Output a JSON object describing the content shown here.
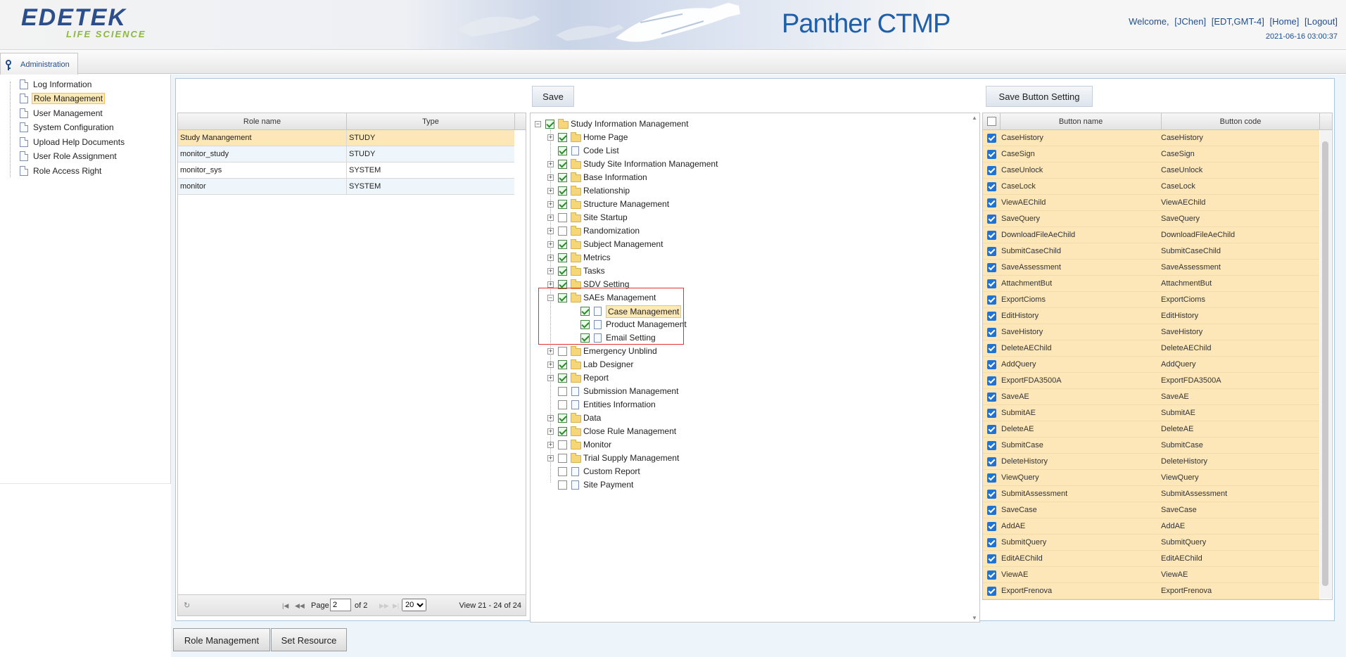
{
  "header": {
    "logo_line1": "EDETEK",
    "logo_line2": "LIFE SCIENCE",
    "app_title": "Panther CTMP",
    "welcome": "Welcome,",
    "user": "[JChen]",
    "timezone": "[EDT,GMT-4]",
    "home_link": "[Home]",
    "logout_link": "[Logout]",
    "datetime": "2021-06-16 03:00:37"
  },
  "tabs": {
    "admin": "Administration"
  },
  "sidebar": {
    "items": [
      {
        "label": "Log Information"
      },
      {
        "label": "Role Management"
      },
      {
        "label": "User Management"
      },
      {
        "label": "System Configuration"
      },
      {
        "label": "Upload Help Documents"
      },
      {
        "label": "User Role Assignment"
      },
      {
        "label": "Role Access Right"
      }
    ],
    "selected": "Role Management"
  },
  "toolbar": {
    "save": "Save",
    "save_button_setting": "Save Button Setting"
  },
  "roles": {
    "columns": [
      "Role name",
      "Type"
    ],
    "rows": [
      {
        "name": "Study Manangement",
        "type": "STUDY"
      },
      {
        "name": "monitor_study",
        "type": "STUDY"
      },
      {
        "name": "monitor_sys",
        "type": "SYSTEM"
      },
      {
        "name": "monitor",
        "type": "SYSTEM"
      }
    ],
    "pager": {
      "page_label": "Page",
      "page": "2",
      "of": "of 2",
      "page_size": "20",
      "view": "View 21 - 24 of 24"
    }
  },
  "tree": {
    "root": "Study Information Management",
    "nodes": [
      {
        "label": "Home Page",
        "checked": true
      },
      {
        "label": "Code List",
        "checked": true
      },
      {
        "label": "Study Site Information Management",
        "checked": true
      },
      {
        "label": "Base Information",
        "checked": true
      },
      {
        "label": "Relationship",
        "checked": true
      },
      {
        "label": "Structure Management",
        "checked": true
      },
      {
        "label": "Site Startup",
        "checked": false
      },
      {
        "label": "Randomization",
        "checked": false
      },
      {
        "label": "Subject Management",
        "checked": true
      },
      {
        "label": "Metrics",
        "checked": true
      },
      {
        "label": "Tasks",
        "checked": true
      },
      {
        "label": "SDV Setting",
        "checked": true
      },
      {
        "label": "SAEs Management",
        "checked": true
      },
      {
        "label": "Case Management",
        "checked": true
      },
      {
        "label": "Product Management",
        "checked": true
      },
      {
        "label": "Email Setting",
        "checked": true
      },
      {
        "label": "Emergency Unblind",
        "checked": false
      },
      {
        "label": "Lab Designer",
        "checked": true
      },
      {
        "label": "Report",
        "checked": true
      },
      {
        "label": "Submission Management",
        "checked": false
      },
      {
        "label": "Entities Information",
        "checked": false
      },
      {
        "label": "Data",
        "checked": true
      },
      {
        "label": "Close Rule Management",
        "checked": true
      },
      {
        "label": "Monitor",
        "checked": false
      },
      {
        "label": "Trial Supply Management",
        "checked": false
      },
      {
        "label": "Custom Report",
        "checked": false
      },
      {
        "label": "Site Payment",
        "checked": false
      }
    ]
  },
  "buttons": {
    "columns": [
      "Button name",
      "Button code"
    ],
    "rows": [
      [
        "CaseHistory",
        "CaseHistory"
      ],
      [
        "CaseSign",
        "CaseSign"
      ],
      [
        "CaseUnlock",
        "CaseUnlock"
      ],
      [
        "CaseLock",
        "CaseLock"
      ],
      [
        "ViewAEChild",
        "ViewAEChild"
      ],
      [
        "SaveQuery",
        "SaveQuery"
      ],
      [
        "DownloadFileAeChild",
        "DownloadFileAeChild"
      ],
      [
        "SubmitCaseChild",
        "SubmitCaseChild"
      ],
      [
        "SaveAssessment",
        "SaveAssessment"
      ],
      [
        "AttachmentBut",
        "AttachmentBut"
      ],
      [
        "ExportCioms",
        "ExportCioms"
      ],
      [
        "EditHistory",
        "EditHistory"
      ],
      [
        "SaveHistory",
        "SaveHistory"
      ],
      [
        "DeleteAEChild",
        "DeleteAEChild"
      ],
      [
        "AddQuery",
        "AddQuery"
      ],
      [
        "ExportFDA3500A",
        "ExportFDA3500A"
      ],
      [
        "SaveAE",
        "SaveAE"
      ],
      [
        "SubmitAE",
        "SubmitAE"
      ],
      [
        "DeleteAE",
        "DeleteAE"
      ],
      [
        "SubmitCase",
        "SubmitCase"
      ],
      [
        "DeleteHistory",
        "DeleteHistory"
      ],
      [
        "ViewQuery",
        "ViewQuery"
      ],
      [
        "SubmitAssessment",
        "SubmitAssessment"
      ],
      [
        "SaveCase",
        "SaveCase"
      ],
      [
        "AddAE",
        "AddAE"
      ],
      [
        "SubmitQuery",
        "SubmitQuery"
      ],
      [
        "EditAEChild",
        "EditAEChild"
      ],
      [
        "ViewAE",
        "ViewAE"
      ],
      [
        "ExportFrenova",
        "ExportFrenova"
      ]
    ]
  },
  "bottom_tabs": {
    "role_management": "Role Management",
    "set_resource": "Set Resource"
  },
  "colors": {
    "accent": "#1f5ea8",
    "selected_row": "#fde7b9",
    "highlight_box": "#e03232",
    "link": "#1f4e90"
  }
}
